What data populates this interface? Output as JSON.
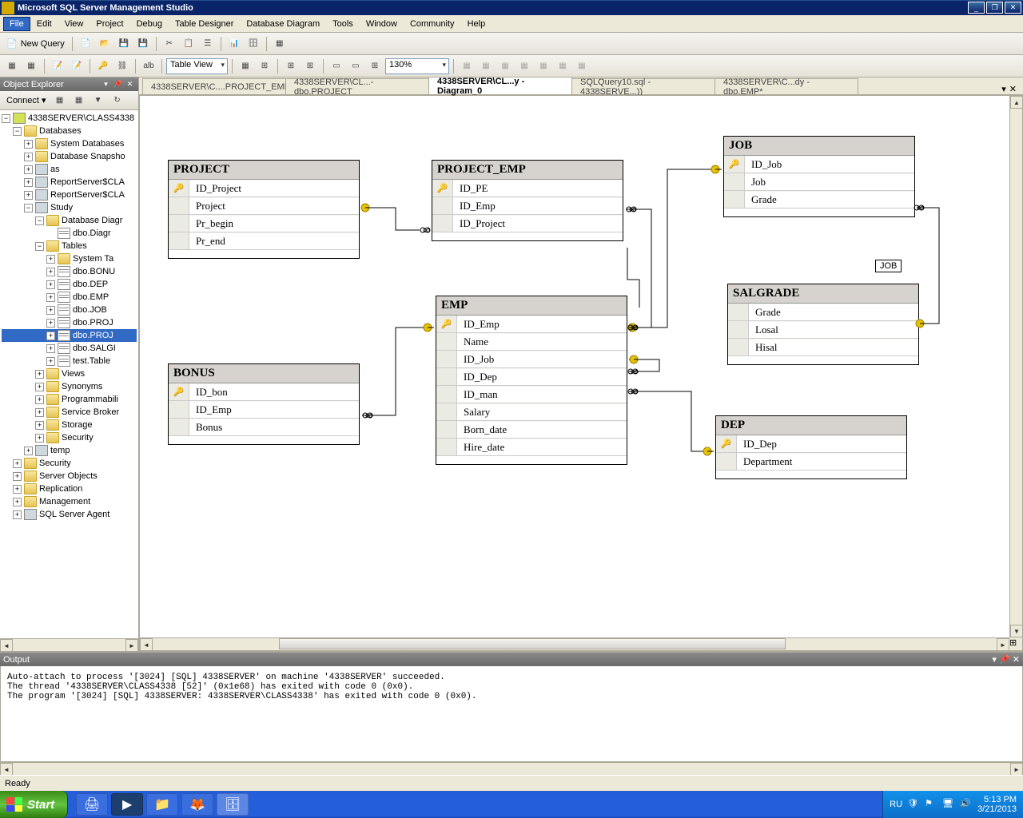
{
  "window": {
    "title": "Microsoft SQL Server Management Studio"
  },
  "menu": {
    "items": [
      "File",
      "Edit",
      "View",
      "Project",
      "Debug",
      "Table Designer",
      "Database Diagram",
      "Tools",
      "Window",
      "Community",
      "Help"
    ]
  },
  "toolbar1": {
    "newquery": "New Query",
    "tableview": "Table View",
    "zoom": "130%"
  },
  "objexp": {
    "title": "Object Explorer",
    "connect": "Connect",
    "server": "4338SERVER\\CLASS4338",
    "nodes": {
      "databases": "Databases",
      "sysdb": "System Databases",
      "dbsnap": "Database Snapsho",
      "as": "as",
      "rs1": "ReportServer$CLA",
      "rs2": "ReportServer$CLA",
      "study": "Study",
      "dbdiag": "Database Diagr",
      "dbod": "dbo.Diagr",
      "tables": "Tables",
      "syst": "System Ta",
      "t1": "dbo.BONU",
      "t2": "dbo.DEP",
      "t3": "dbo.EMP",
      "t4": "dbo.JOB",
      "t5": "dbo.PROJ",
      "t6": "dbo.PROJ",
      "t7": "dbo.SALGI",
      "t8": "test.Table",
      "views": "Views",
      "syn": "Synonyms",
      "prog": "Programmabili",
      "sbrok": "Service Broker",
      "stor": "Storage",
      "sec": "Security",
      "temp": "temp",
      "security": "Security",
      "srvobj": "Server Objects",
      "repl": "Replication",
      "mgmt": "Management",
      "agent": "SQL Server Agent"
    }
  },
  "tabs": {
    "t1": "4338SERVER\\C....PROJECT_EMP",
    "t2": "4338SERVER\\CL...- dbo.PROJECT",
    "t3": "4338SERVER\\CL...y - Diagram_0",
    "t4": "SQLQuery10.sql - 4338SERVE...))",
    "t5": "4338SERVER\\C...dy - dbo.EMP*"
  },
  "diagram": {
    "tables": {
      "project": {
        "name": "PROJECT",
        "cols": [
          {
            "n": "ID_Project",
            "pk": true
          },
          {
            "n": "Project"
          },
          {
            "n": "Pr_begin"
          },
          {
            "n": "Pr_end"
          }
        ]
      },
      "project_emp": {
        "name": "PROJECT_EMP",
        "cols": [
          {
            "n": "ID_PE",
            "pk": true
          },
          {
            "n": "ID_Emp"
          },
          {
            "n": "ID_Project"
          }
        ]
      },
      "job": {
        "name": "JOB",
        "cols": [
          {
            "n": "ID_Job",
            "pk": true
          },
          {
            "n": "Job"
          },
          {
            "n": "Grade"
          }
        ]
      },
      "salgrade": {
        "name": "SALGRADE",
        "cols": [
          {
            "n": "Grade"
          },
          {
            "n": "Losal"
          },
          {
            "n": "Hisal"
          }
        ]
      },
      "emp": {
        "name": "EMP",
        "cols": [
          {
            "n": "ID_Emp",
            "pk": true
          },
          {
            "n": "Name"
          },
          {
            "n": "ID_Job"
          },
          {
            "n": "ID_Dep"
          },
          {
            "n": "ID_man"
          },
          {
            "n": "Salary"
          },
          {
            "n": "Born_date"
          },
          {
            "n": "Hire_date"
          }
        ]
      },
      "bonus": {
        "name": "BONUS",
        "cols": [
          {
            "n": "ID_bon",
            "pk": true
          },
          {
            "n": "ID_Emp"
          },
          {
            "n": "Bonus"
          }
        ]
      },
      "dep": {
        "name": "DEP",
        "cols": [
          {
            "n": "ID_Dep",
            "pk": true
          },
          {
            "n": "Department"
          }
        ]
      }
    },
    "float": "JOB"
  },
  "output": {
    "title": "Output",
    "lines": [
      "",
      "Auto-attach to process '[3024] [SQL] 4338SERVER' on machine '4338SERVER' succeeded.",
      "The thread '4338SERVER\\CLASS4338 [52]' (0x1e68) has exited with code 0 (0x0).",
      "The program '[3024] [SQL] 4338SERVER: 4338SERVER\\CLASS4338' has exited with code 0 (0x0)."
    ]
  },
  "status": {
    "text": "Ready"
  },
  "taskbar": {
    "start": "Start",
    "lang": "RU",
    "time": "5:13 PM",
    "date": "3/21/2013"
  }
}
